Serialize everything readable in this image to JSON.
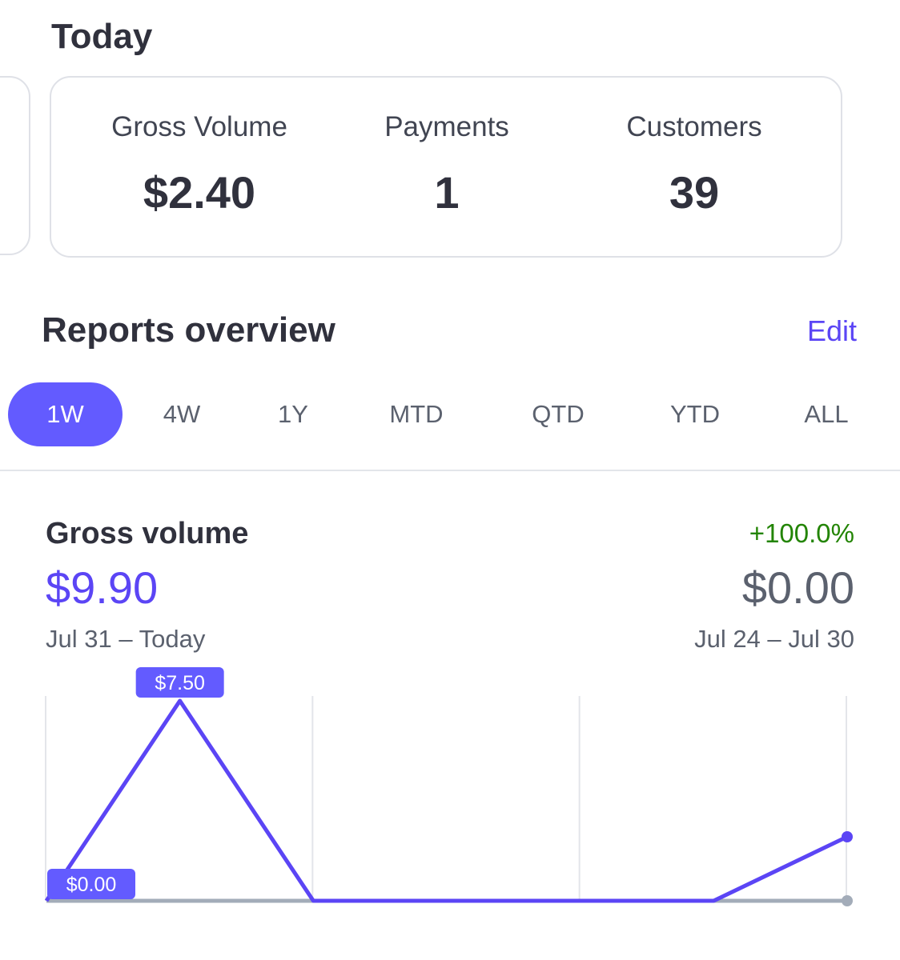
{
  "today": {
    "title": "Today",
    "stats": [
      {
        "label": "Gross Volume",
        "value": "$2.40"
      },
      {
        "label": "Payments",
        "value": "1"
      },
      {
        "label": "Customers",
        "value": "39"
      }
    ]
  },
  "reports": {
    "title": "Reports overview",
    "edit_label": "Edit",
    "tabs": [
      "1W",
      "4W",
      "1Y",
      "MTD",
      "QTD",
      "YTD",
      "ALL"
    ],
    "active_tab": "1W"
  },
  "gross_volume": {
    "title": "Gross volume",
    "change": "+100.0%",
    "current_value": "$9.90",
    "current_range": "Jul 31 – Today",
    "previous_value": "$0.00",
    "previous_range": "Jul 24 – Jul 30",
    "colors": {
      "current": "#5b45f5",
      "previous": "#a3acb9",
      "change": "#228403"
    }
  },
  "chart_data": {
    "type": "line",
    "series": [
      {
        "values": [
          0,
          7.5,
          0,
          0,
          0,
          0,
          2.4
        ]
      },
      {
        "values": [
          0,
          0,
          0,
          0,
          0,
          0,
          0
        ]
      }
    ],
    "callouts": [
      "$7.50",
      "$0.00"
    ],
    "ylim": [
      0,
      7.5
    ],
    "grid": true
  }
}
